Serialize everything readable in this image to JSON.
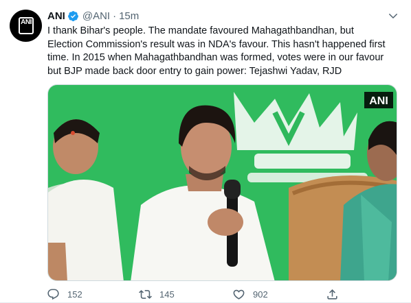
{
  "tweet": {
    "author_name": "ANI",
    "handle": "@ANI",
    "separator": "·",
    "time": "15m",
    "avatar_text": "ANI",
    "text_lines": [
      "I thank Bihar's people. The mandate favoured Mahagathbandhan, but",
      "Election Commission's result was in NDA's favour. This hasn't happened first",
      "time. In 2015 when Mahagathbandhan was formed, votes were in our favour",
      "but BJP made back door entry to gain power: Tejashwi Yadav, RJD"
    ],
    "media": {
      "watermark": "ANI"
    },
    "actions": {
      "reply_count": "152",
      "retweet_count": "145",
      "like_count": "902"
    }
  },
  "colors": {
    "text": "#0f1419",
    "secondary": "#536471",
    "verified": "#1d9bf0",
    "backdrop_green": "#29b75a"
  },
  "icons": [
    "verified-badge-icon",
    "caret-down-icon",
    "reply-icon",
    "retweet-icon",
    "like-icon",
    "share-icon"
  ]
}
